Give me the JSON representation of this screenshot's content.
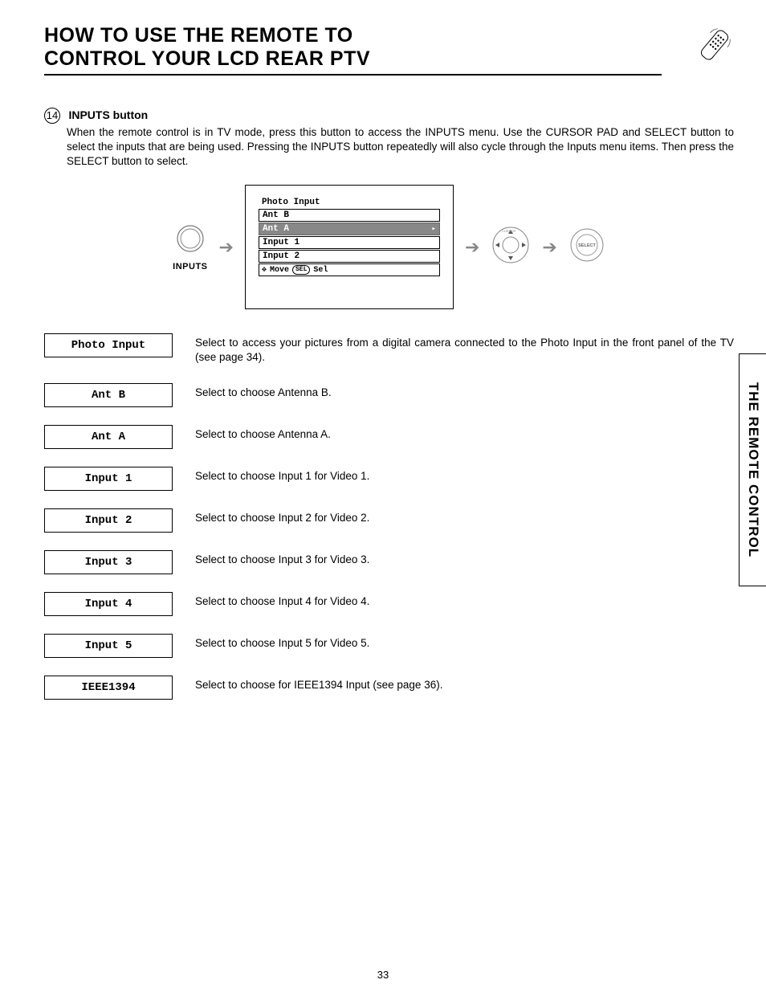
{
  "title": {
    "line1": "HOW TO USE THE REMOTE TO",
    "line2": "CONTROL YOUR LCD REAR PTV"
  },
  "section": {
    "item_number": "14",
    "heading": "INPUTS button",
    "description": "When the remote control is in TV mode, press this button to access the INPUTS menu.  Use the CURSOR PAD and SELECT button to select the inputs that are being used.  Pressing the INPUTS button repeatedly will also cycle through the Inputs menu items.  Then press the SELECT button to select."
  },
  "diagram": {
    "button_label": "INPUTS",
    "menu_title": "Photo Input",
    "menu_items": [
      "Ant B",
      "Ant A",
      "Input 1",
      "Input 2"
    ],
    "selected_index": 1,
    "footer_move": "Move",
    "footer_sel_badge": "SEL",
    "footer_sel": "Sel",
    "select_label": "SELECT"
  },
  "rows": [
    {
      "label": "Photo Input",
      "desc": "Select to access your pictures from a digital camera connected to the Photo Input in the front panel of the TV (see page 34)."
    },
    {
      "label": "Ant B",
      "desc": "Select to choose Antenna B."
    },
    {
      "label": "Ant A",
      "desc": "Select to choose Antenna A."
    },
    {
      "label": "Input 1",
      "desc": "Select to choose Input 1 for Video 1."
    },
    {
      "label": "Input 2",
      "desc": "Select to choose Input 2 for Video 2."
    },
    {
      "label": "Input 3",
      "desc": "Select to choose Input 3 for Video 3."
    },
    {
      "label": "Input 4",
      "desc": "Select to choose Input 4 for Video 4."
    },
    {
      "label": "Input 5",
      "desc": "Select to choose Input 5 for Video 5."
    },
    {
      "label": "IEEE1394",
      "desc": "Select to choose for IEEE1394 Input (see page 36)."
    }
  ],
  "side_tab": "THE REMOTE CONTROL",
  "page_number": "33"
}
